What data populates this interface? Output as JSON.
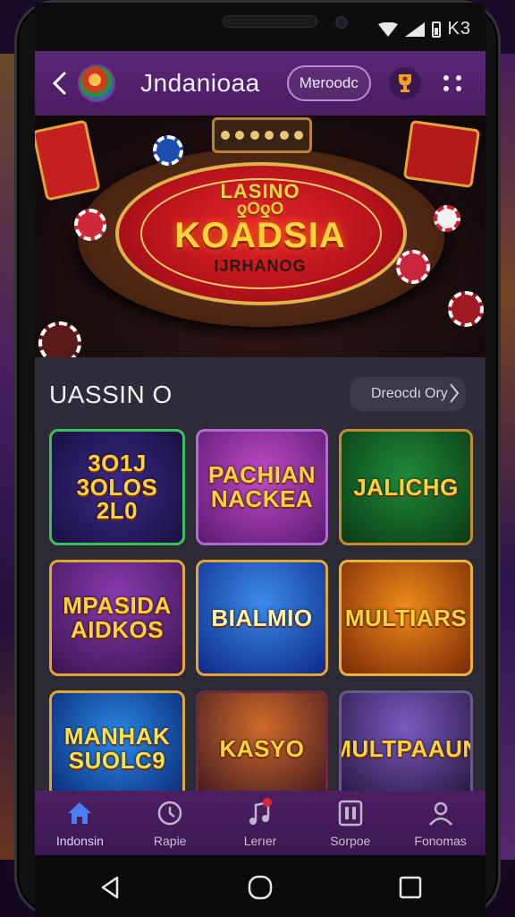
{
  "status_bar": {
    "time": "K3"
  },
  "header": {
    "title": "Jndanioaa",
    "pill_label": "Mɐroodc"
  },
  "banner": {
    "line1": "LASINO",
    "line2": "ƍOƍO",
    "title": "KOADSIA",
    "subtitle": "IJRHANOG"
  },
  "section": {
    "title": "UASSIN O",
    "view_all_label": "Dreocdı",
    "view_all_more": "Ory"
  },
  "games": [
    {
      "label": "3O1J 3OLOS 2L0"
    },
    {
      "label": "PACHIAN NACKEA"
    },
    {
      "label": "JALICHG"
    },
    {
      "label": "MPASIDA AIDKOS"
    },
    {
      "label": "BIALMIO"
    },
    {
      "label": "MULTIARS"
    },
    {
      "label": "MANHAK SUOLC9"
    },
    {
      "label": "KASYO"
    },
    {
      "label": "MULTPAAUN"
    }
  ],
  "bottom_nav": [
    {
      "label": "Indonsin",
      "icon": "home-icon",
      "active": true
    },
    {
      "label": "Rapie",
      "icon": "clock-icon",
      "active": false
    },
    {
      "label": "Lerıer",
      "icon": "music-icon",
      "active": false
    },
    {
      "label": "Sorpoe",
      "icon": "frame-icon",
      "active": false
    },
    {
      "label": "Fonomas",
      "icon": "profile-icon",
      "active": false
    }
  ],
  "colors": {
    "header_bg": "#5b2677",
    "accent_gold": "#ffd23c",
    "nav_active": "#4a7ef0"
  }
}
